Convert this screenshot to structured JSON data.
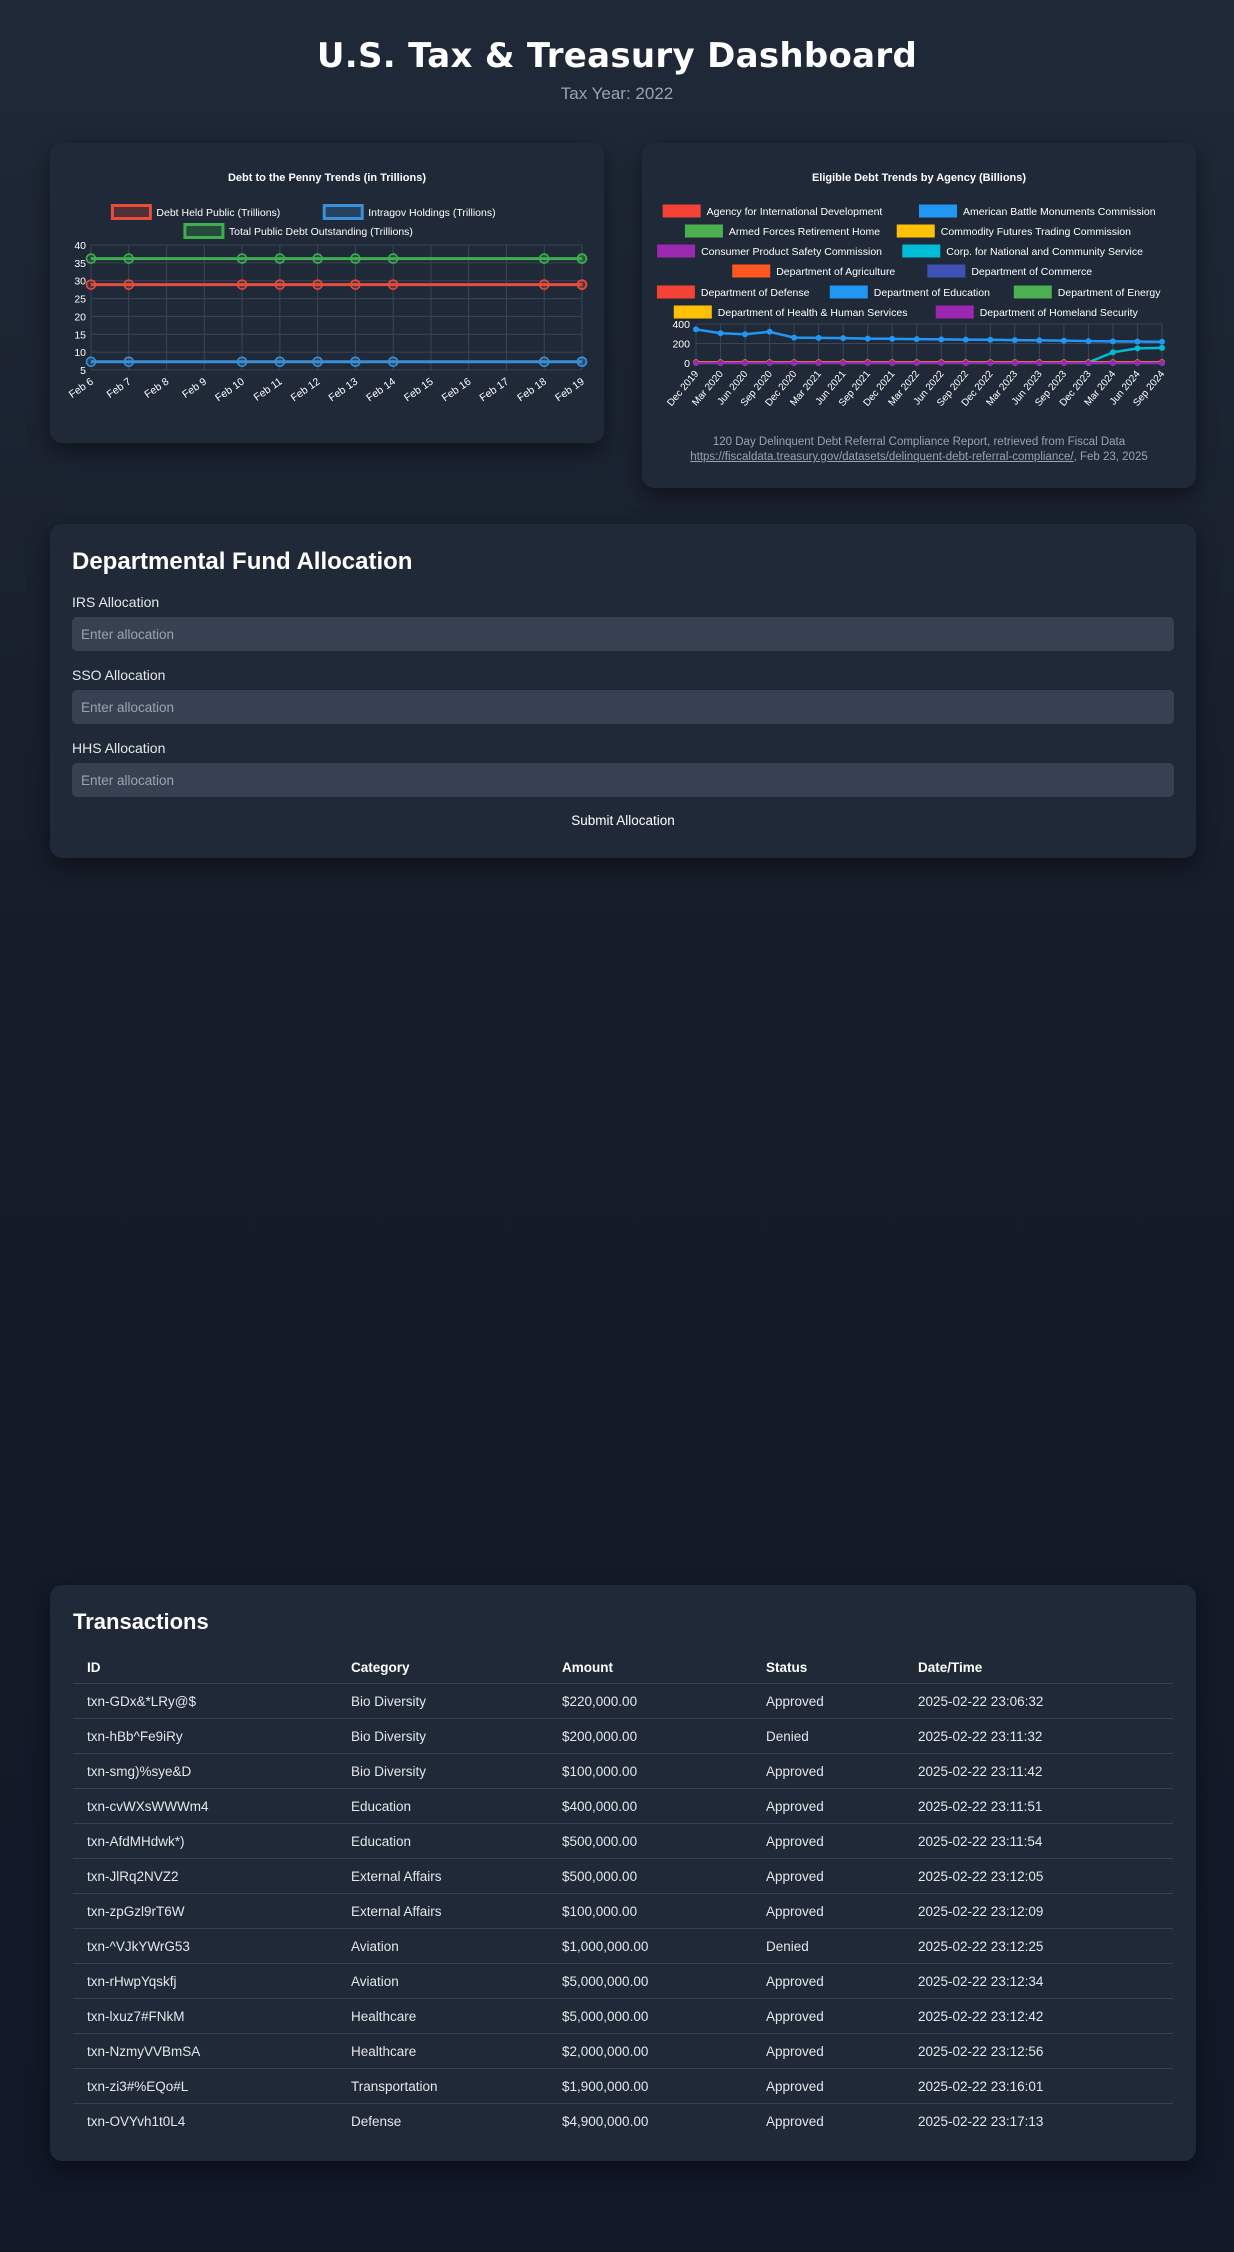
{
  "header": {
    "title": "U.S. Tax & Treasury Dashboard",
    "subtitle": "Tax Year: 2022"
  },
  "chart_data": [
    {
      "type": "line",
      "title": "Debt to the Penny Trends (in Trillions)",
      "x": [
        "Feb 6",
        "Feb 7",
        "Feb 8",
        "Feb 9",
        "Feb 10",
        "Feb 11",
        "Feb 12",
        "Feb 13",
        "Feb 14",
        "Feb 15",
        "Feb 16",
        "Feb 17",
        "Feb 18",
        "Feb 19"
      ],
      "y_ticks": [
        5,
        10,
        15,
        20,
        25,
        30,
        35,
        40
      ],
      "ylim": [
        5,
        40
      ],
      "legend_placement": "top",
      "grid": true,
      "series": [
        {
          "name": "Debt Held Public (Trillions)",
          "color": "#e74c3c",
          "values": [
            28.9,
            28.9,
            null,
            null,
            28.9,
            28.9,
            28.9,
            28.9,
            28.9,
            null,
            null,
            null,
            28.9,
            28.9,
            28.9
          ]
        },
        {
          "name": "Intragov Holdings (Trillions)",
          "color": "#3a8fd6",
          "values": [
            7.3,
            7.3,
            null,
            null,
            7.3,
            7.3,
            7.3,
            7.3,
            7.3,
            null,
            null,
            null,
            7.3,
            7.3,
            7.3
          ]
        },
        {
          "name": "Total Public Debt Outstanding (Trillions)",
          "color": "#3fae4f",
          "values": [
            36.2,
            36.2,
            null,
            null,
            36.2,
            36.2,
            36.2,
            36.2,
            36.2,
            null,
            null,
            null,
            36.2,
            36.2,
            36.2
          ]
        }
      ]
    },
    {
      "type": "line",
      "title": "Eligible Debt Trends by Agency (Billions)",
      "x": [
        "Dec 2019",
        "Mar 2020",
        "Jun 2020",
        "Sep 2020",
        "Dec 2020",
        "Mar 2021",
        "Jun 2021",
        "Sep 2021",
        "Dec 2021",
        "Mar 2022",
        "Jun 2022",
        "Sep 2022",
        "Dec 2022",
        "Mar 2023",
        "Jun 2023",
        "Sep 2023",
        "Dec 2023",
        "Mar 2024",
        "Jun 2024",
        "Sep 2024"
      ],
      "y_ticks": [
        0,
        200,
        400
      ],
      "ylim": [
        0,
        400
      ],
      "legend_placement": "top",
      "grid": true,
      "series": [
        {
          "name": "Agency for International Development",
          "color": "#f44336",
          "values": [
            2,
            2,
            2,
            2,
            2,
            2,
            2,
            2,
            2,
            2,
            2,
            2,
            2,
            2,
            2,
            2,
            2,
            2,
            2,
            2
          ]
        },
        {
          "name": "American Battle Monuments Commission",
          "color": "#2196f3",
          "values": [
            345,
            305,
            295,
            320,
            260,
            258,
            255,
            250,
            248,
            245,
            242,
            240,
            238,
            235,
            232,
            230,
            225,
            222,
            220,
            218
          ]
        },
        {
          "name": "Armed Forces Retirement Home",
          "color": "#4caf50",
          "values": [
            1,
            1,
            1,
            1,
            1,
            1,
            1,
            1,
            1,
            1,
            1,
            1,
            1,
            1,
            1,
            1,
            1,
            1,
            1,
            1
          ]
        },
        {
          "name": "Commodity Futures Trading Commission",
          "color": "#ffc107",
          "values": [
            3,
            3,
            3,
            3,
            3,
            3,
            3,
            3,
            3,
            3,
            3,
            3,
            3,
            3,
            3,
            3,
            3,
            3,
            3,
            3
          ]
        },
        {
          "name": "Consumer Product Safety Commission",
          "color": "#9c27b0",
          "values": [
            1,
            1,
            1,
            1,
            1,
            1,
            1,
            1,
            1,
            1,
            1,
            1,
            1,
            1,
            1,
            1,
            1,
            1,
            1,
            1
          ]
        },
        {
          "name": "Corp. for National and Community Service",
          "color": "#00bcd4",
          "values": [
            5,
            5,
            5,
            5,
            5,
            5,
            5,
            5,
            5,
            5,
            5,
            5,
            5,
            5,
            5,
            5,
            5,
            110,
            150,
            155
          ]
        },
        {
          "name": "Department of Agriculture",
          "color": "#ff5722",
          "values": [
            4,
            4,
            4,
            4,
            4,
            4,
            4,
            4,
            4,
            4,
            4,
            4,
            4,
            4,
            4,
            4,
            4,
            4,
            4,
            4
          ]
        },
        {
          "name": "Department of Commerce",
          "color": "#3f51b5",
          "values": [
            2,
            2,
            2,
            2,
            2,
            2,
            2,
            2,
            2,
            2,
            2,
            2,
            2,
            2,
            2,
            2,
            2,
            2,
            2,
            2
          ]
        },
        {
          "name": "Department of Defense",
          "color": "#f44336",
          "values": [
            6,
            6,
            6,
            6,
            6,
            6,
            6,
            6,
            6,
            6,
            6,
            6,
            6,
            6,
            6,
            6,
            6,
            6,
            6,
            6
          ]
        },
        {
          "name": "Department of Education",
          "color": "#2196f3",
          "values": [
            3,
            3,
            3,
            3,
            3,
            3,
            3,
            3,
            3,
            3,
            3,
            3,
            3,
            3,
            3,
            3,
            3,
            3,
            3,
            3
          ]
        },
        {
          "name": "Department of Energy",
          "color": "#4caf50",
          "values": [
            2,
            2,
            2,
            2,
            2,
            2,
            2,
            2,
            2,
            2,
            2,
            2,
            2,
            2,
            2,
            2,
            2,
            2,
            2,
            2
          ]
        },
        {
          "name": "Department of Health & Human Services",
          "color": "#ffc107",
          "values": [
            8,
            8,
            8,
            8,
            8,
            8,
            8,
            8,
            8,
            8,
            8,
            8,
            8,
            8,
            8,
            8,
            8,
            8,
            8,
            8
          ]
        },
        {
          "name": "Department of Homeland Security",
          "color": "#9c27b0",
          "values": [
            3,
            3,
            3,
            3,
            3,
            3,
            3,
            3,
            3,
            3,
            3,
            3,
            3,
            3,
            3,
            3,
            3,
            3,
            3,
            3
          ]
        }
      ],
      "source_note": "120 Day Delinquent Debt Referral Compliance Report, retrieved from Fiscal Data",
      "source_link": "https://fiscaldata.treasury.gov/datasets/delinquent-debt-referral-compliance/",
      "source_date": ", Feb 23, 2025"
    }
  ],
  "allocation": {
    "title": "Departmental Fund Allocation",
    "fields": [
      {
        "label": "IRS Allocation",
        "placeholder": "Enter allocation"
      },
      {
        "label": "SSO Allocation",
        "placeholder": "Enter allocation"
      },
      {
        "label": "HHS Allocation",
        "placeholder": "Enter allocation"
      }
    ],
    "submit_label": "Submit Allocation"
  },
  "transactions": {
    "title": "Transactions",
    "columns": [
      "ID",
      "Category",
      "Amount",
      "Status",
      "Date/Time"
    ],
    "rows": [
      [
        "txn-GDx&*LRy@$",
        "Bio Diversity",
        "$220,000.00",
        "Approved",
        "2025-02-22 23:06:32"
      ],
      [
        "txn-hBb^Fe9iRy",
        "Bio Diversity",
        "$200,000.00",
        "Denied",
        "2025-02-22 23:11:32"
      ],
      [
        "txn-smg)%sye&D",
        "Bio Diversity",
        "$100,000.00",
        "Approved",
        "2025-02-22 23:11:42"
      ],
      [
        "txn-cvWXsWWWm4",
        "Education",
        "$400,000.00",
        "Approved",
        "2025-02-22 23:11:51"
      ],
      [
        "txn-AfdMHdwk*)",
        "Education",
        "$500,000.00",
        "Approved",
        "2025-02-22 23:11:54"
      ],
      [
        "txn-JlRq2NVZ2",
        "External Affairs",
        "$500,000.00",
        "Approved",
        "2025-02-22 23:12:05"
      ],
      [
        "txn-zpGzl9rT6W",
        "External Affairs",
        "$100,000.00",
        "Approved",
        "2025-02-22 23:12:09"
      ],
      [
        "txn-^VJkYWrG53",
        "Aviation",
        "$1,000,000.00",
        "Denied",
        "2025-02-22 23:12:25"
      ],
      [
        "txn-rHwpYqskfj",
        "Aviation",
        "$5,000,000.00",
        "Approved",
        "2025-02-22 23:12:34"
      ],
      [
        "txn-lxuz7#FNkM",
        "Healthcare",
        "$5,000,000.00",
        "Approved",
        "2025-02-22 23:12:42"
      ],
      [
        "txn-NzmyVVBmSA",
        "Healthcare",
        "$2,000,000.00",
        "Approved",
        "2025-02-22 23:12:56"
      ],
      [
        "txn-zi3#%EQo#L",
        "Transportation",
        "$1,900,000.00",
        "Approved",
        "2025-02-22 23:16:01"
      ],
      [
        "txn-OVYvh1t0L4",
        "Defense",
        "$4,900,000.00",
        "Approved",
        "2025-02-22 23:17:13"
      ]
    ]
  }
}
